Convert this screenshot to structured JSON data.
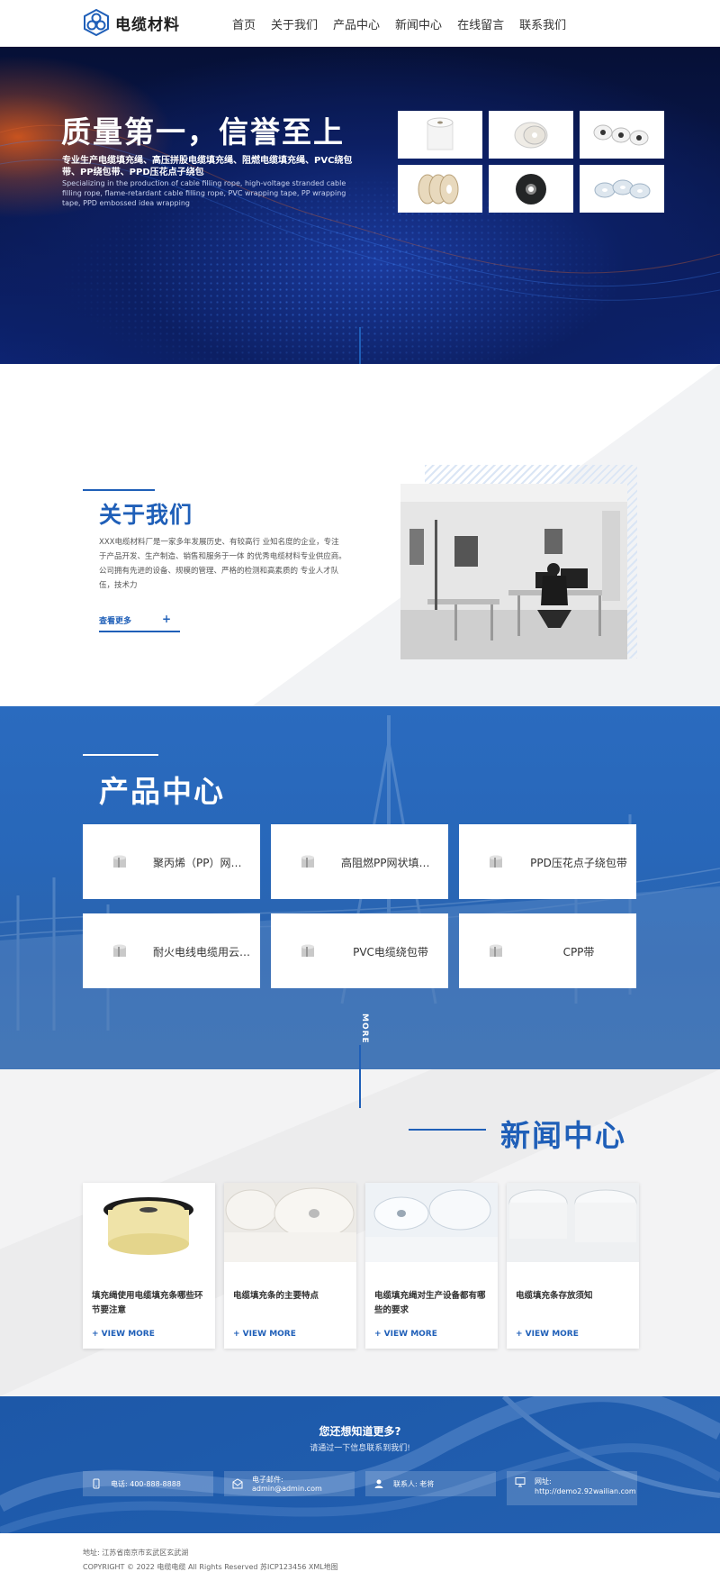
{
  "header": {
    "logo_text": "电缆材料",
    "nav": [
      "首页",
      "关于我们",
      "产品中心",
      "新闻中心",
      "在线留言",
      "联系我们"
    ]
  },
  "hero": {
    "title": "质量第一，信誉至上",
    "subtitle": "专业生产电缆填充绳、高压拼股电缆填充绳、阻燃电缆填充绳、PVC绕包带、PP绕包带、PPD压花点子绕包",
    "english": "Specializing in the production of cable filling rope, high-voltage stranded cable filling rope, flame-retardant cable filling rope, PVC wrapping tape, PP wrapping tape, PPD embossed idea wrapping"
  },
  "about": {
    "title": "关于我们",
    "text": "XXX电缆材料厂是一家多年发展历史、有较高行 业知名度的企业，专注于产品开发、生产制造、销售和服务于一体 的优秀电缆材料专业供应商。公司拥有先进的设备、规模的管理、严格的检测和高素质的 专业人才队伍，技术力",
    "more_label": "查看更多",
    "more_plus": "+"
  },
  "products": {
    "title": "产品中心",
    "items": [
      "聚丙烯（PP）网状填充绳",
      "高阻燃PP网状填充绳",
      "PPD压花点子绕包带",
      "耐火电线电缆用云母带",
      "PVC电缆绕包带",
      "CPP带"
    ],
    "more_label": "MORE"
  },
  "news": {
    "title": "新闻中心",
    "items": [
      {
        "title": "填充绳使用电缆填充条哪些环节要注意",
        "more": "+ VIEW MORE"
      },
      {
        "title": "电缆填充条的主要特点",
        "more": "+ VIEW MORE"
      },
      {
        "title": "电缆填充绳对生产设备都有哪些的要求",
        "more": "+ VIEW MORE"
      },
      {
        "title": "电缆填充条存放须知",
        "more": "+ VIEW MORE"
      }
    ]
  },
  "contact": {
    "title": "您还想知道更多?",
    "subtitle": "请通过一下信息联系到我们!",
    "phone": "电话: 400-888-8888",
    "email": "电子邮件: admin@admin.com",
    "person": "联系人: 老将",
    "website_label": "网址:",
    "website": "http://demo2.92wailian.com"
  },
  "footer": {
    "address": "地址: 江苏省南京市玄武区玄武湖",
    "copyright": "COPYRIGHT © 2022 电缆电缆 All Rights Reserved 苏ICP123456 XML地图"
  },
  "colors": {
    "brand_blue": "#1f5fb8",
    "hero_dark": "#0a1a55",
    "accent_orange": "#c8531f"
  }
}
